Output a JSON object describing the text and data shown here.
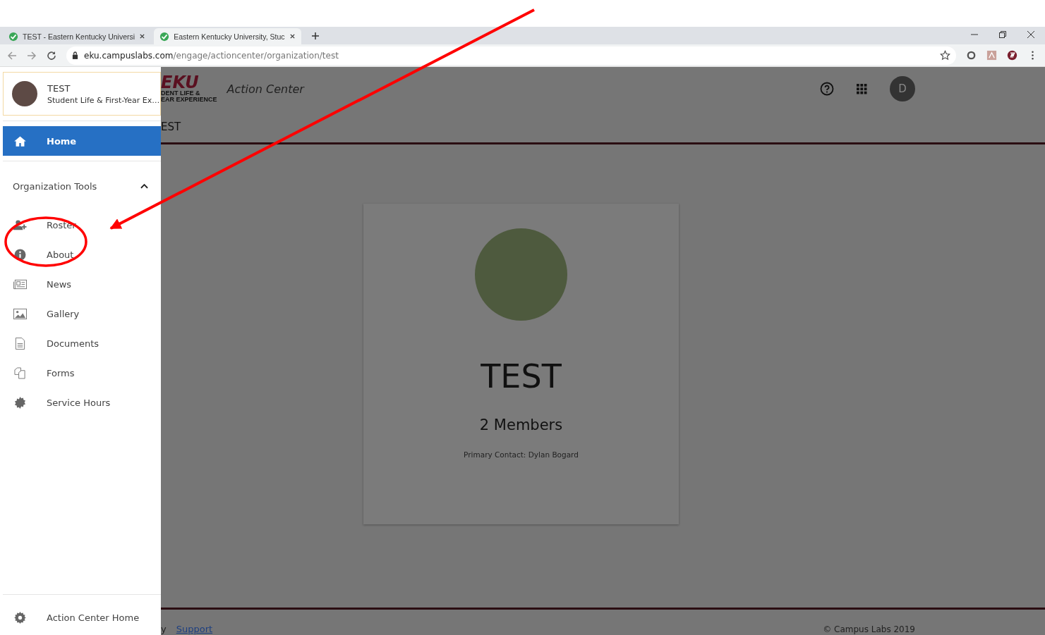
{
  "browser": {
    "tabs": [
      {
        "title": "TEST - Eastern Kentucky Universi",
        "selected": false
      },
      {
        "title": "Eastern Kentucky University, Stuc",
        "selected": true
      }
    ],
    "url_host": "eku.campuslabs.com",
    "url_path": "/engage/actioncenter/organization/test"
  },
  "header": {
    "logo": "EKU",
    "logo_line_1": "DENT LIFE &",
    "logo_line_2": "EAR EXPERIENCE",
    "app_title": "Action Center",
    "avatar": "D"
  },
  "page_title": "EST",
  "drawer": {
    "org_name": "TEST",
    "org_subtitle": "Student Life & First-Year Ex…",
    "home": {
      "label": "Home",
      "selected": true
    },
    "section": {
      "label": "Organization Tools",
      "expanded": true,
      "items": [
        {
          "label": "Roster",
          "kind": "roster",
          "selected": false
        },
        {
          "label": "About",
          "kind": "info",
          "selected": false
        },
        {
          "label": "News",
          "kind": "news",
          "selected": false
        },
        {
          "label": "Gallery",
          "kind": "gallery",
          "selected": false
        },
        {
          "label": "Documents",
          "kind": "document",
          "selected": false
        },
        {
          "label": "Forms",
          "kind": "forms",
          "selected": false
        },
        {
          "label": "Service Hours",
          "kind": "badge",
          "selected": false
        }
      ]
    },
    "footer_item": "Action Center Home"
  },
  "card": {
    "name": "TEST",
    "members": "2 Members",
    "contact": "Primary Contact: Dylan Bogard"
  },
  "footer": {
    "partial": "y",
    "link": "Support",
    "copyright": "© Campus Labs 2019"
  },
  "markup": {
    "arrow": true,
    "ellipse": true
  }
}
